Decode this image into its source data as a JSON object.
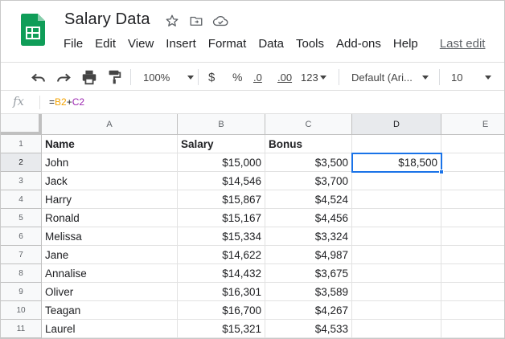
{
  "app": {
    "title": "Salary Data",
    "icons": [
      "star-icon",
      "move-to-folder-icon",
      "cloud-saved-icon"
    ]
  },
  "menu": {
    "items": [
      "File",
      "Edit",
      "View",
      "Insert",
      "Format",
      "Data",
      "Tools",
      "Add-ons",
      "Help"
    ],
    "last_edit": "Last edit"
  },
  "toolbar": {
    "zoom": "100%",
    "currency": "$",
    "percent": "%",
    "decrease_decimal": ".0",
    "increase_decimal": ".00",
    "more_formats": "123",
    "font": "Default (Ari...",
    "font_size": "10"
  },
  "formula_bar": {
    "fx": "fx",
    "formula_eq": "=",
    "ref1": "B2",
    "op": "+",
    "ref2": "C2"
  },
  "colors": {
    "accent": "#1a73e8",
    "ref1": "#f4a300",
    "ref2": "#9c27b0",
    "sheets_green": "#0f9d58"
  },
  "sheet": {
    "columns": [
      "A",
      "B",
      "C",
      "D",
      "E"
    ],
    "rows": [
      "1",
      "2",
      "3",
      "4",
      "5",
      "6",
      "7",
      "8",
      "9",
      "10",
      "11"
    ],
    "active_cell": "D2",
    "headers": {
      "a": "Name",
      "b": "Salary",
      "c": "Bonus"
    },
    "d2": "$18,500",
    "data": [
      {
        "name": "John",
        "salary": "$15,000",
        "bonus": "$3,500"
      },
      {
        "name": "Jack",
        "salary": "$14,546",
        "bonus": "$3,700"
      },
      {
        "name": "Harry",
        "salary": "$15,867",
        "bonus": "$4,524"
      },
      {
        "name": "Ronald",
        "salary": "$15,167",
        "bonus": "$4,456"
      },
      {
        "name": "Melissa",
        "salary": "$15,334",
        "bonus": "$3,324"
      },
      {
        "name": "Jane",
        "salary": "$14,622",
        "bonus": "$4,987"
      },
      {
        "name": "Annalise",
        "salary": "$14,432",
        "bonus": "$3,675"
      },
      {
        "name": "Oliver",
        "salary": "$16,301",
        "bonus": "$3,589"
      },
      {
        "name": "Teagan",
        "salary": "$16,700",
        "bonus": "$4,267"
      },
      {
        "name": "Laurel",
        "salary": "$15,321",
        "bonus": "$4,533"
      }
    ]
  }
}
